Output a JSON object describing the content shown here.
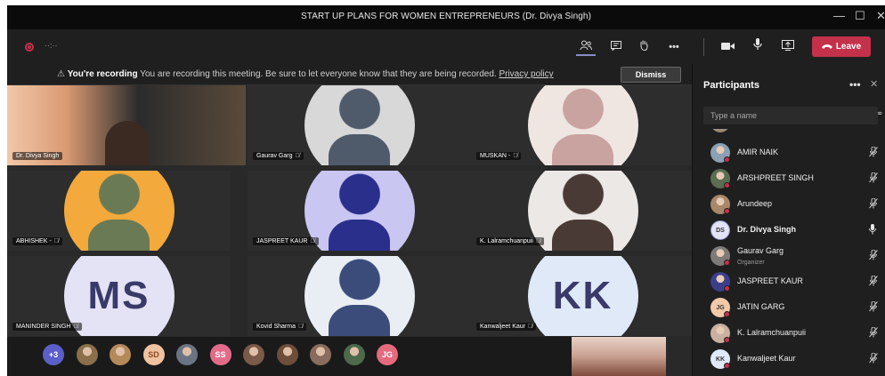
{
  "window": {
    "title": "START UP PLANS FOR WOMEN ENTREPRENEURS (Dr. Divya Singh)",
    "minimize": "—",
    "maximize": "☐",
    "close": "✕"
  },
  "toolbar": {
    "timer": "··:··",
    "leave_label": "Leave",
    "icons": [
      "participants-icon",
      "chat-icon",
      "raise-hand-icon",
      "more-actions-icon",
      "camera-icon",
      "microphone-icon",
      "share-screen-icon",
      "hang-up-icon"
    ]
  },
  "banner": {
    "heading": "You're recording",
    "message": "You are recording this meeting. Be sure to let everyone know that they are being recorded.",
    "link": "Privacy policy",
    "dismiss_label": "Dismiss"
  },
  "tiles": [
    {
      "name": "Dr. Divya Singh",
      "type": "video"
    },
    {
      "name": "Gaurav Garg",
      "type": "photo"
    },
    {
      "name": "MUSKAN -",
      "type": "photo"
    },
    {
      "name": "ABHISHEK -",
      "type": "photo"
    },
    {
      "name": "JASPREET KAUR",
      "type": "photo"
    },
    {
      "name": "K. Lalramchuanpuii",
      "type": "photo"
    },
    {
      "name": "MANINDER SINGH",
      "type": "initials",
      "initials": "MS",
      "color": "#e4e3f6"
    },
    {
      "name": "Kovid Sharma",
      "type": "photo"
    },
    {
      "name": "Kanwaljeet Kaur",
      "type": "initials",
      "initials": "KK",
      "color": "#dfe9f8"
    }
  ],
  "strip": {
    "overflow": "+3",
    "items": [
      {
        "type": "photo",
        "color": "#8a6f4a"
      },
      {
        "type": "photo",
        "color": "#b58a5a"
      },
      {
        "type": "initials",
        "text": "SD",
        "color": "#f0c2a0",
        "textColor": "#8a4b22"
      },
      {
        "type": "photo",
        "color": "#6a7485"
      },
      {
        "type": "initials",
        "text": "SS",
        "color": "#e36b8a",
        "textColor": "#ffffff"
      },
      {
        "type": "photo",
        "color": "#7a5a48"
      },
      {
        "type": "photo",
        "color": "#6d4e3b"
      },
      {
        "type": "photo",
        "color": "#8a6c5e"
      },
      {
        "type": "photo",
        "color": "#4d6a4a"
      },
      {
        "type": "initials",
        "text": "JG",
        "color": "#e46a7e",
        "textColor": "#ffffff"
      }
    ]
  },
  "panel": {
    "title": "Participants",
    "more": "•••",
    "close": "✕",
    "search_placeholder": "Type a name",
    "participants": [
      {
        "name": "AMIR NAIK",
        "role": "",
        "mic": "muted",
        "avatar": "photo",
        "color": "#8aa0b5"
      },
      {
        "name": "ARSHPREET SINGH",
        "role": "",
        "mic": "muted",
        "avatar": "photo",
        "color": "#5c6e52"
      },
      {
        "name": "Arundeep",
        "role": "",
        "mic": "muted",
        "avatar": "photo",
        "color": "#a8886a"
      },
      {
        "name": "Dr. Divya Singh",
        "role": "",
        "mic": "on",
        "avatar": "initials",
        "initials": "DS",
        "color": "#e3e3f5",
        "bold": true
      },
      {
        "name": "Gaurav Garg",
        "role": "Organizer",
        "mic": "muted",
        "avatar": "photo",
        "color": "#7f7a78"
      },
      {
        "name": "JASPREET KAUR",
        "role": "",
        "mic": "muted",
        "avatar": "photo",
        "color": "#3b3f8a"
      },
      {
        "name": "JATIN GARG",
        "role": "",
        "mic": "muted",
        "avatar": "initials",
        "initials": "JG",
        "color": "#f2c9a8"
      },
      {
        "name": "K. Lalramchuanpuii",
        "role": "",
        "mic": "muted",
        "avatar": "photo",
        "color": "#c9b0a0"
      },
      {
        "name": "Kanwaljeet Kaur",
        "role": "",
        "mic": "muted",
        "avatar": "initials",
        "initials": "KK",
        "color": "#dfe9f8"
      }
    ]
  }
}
